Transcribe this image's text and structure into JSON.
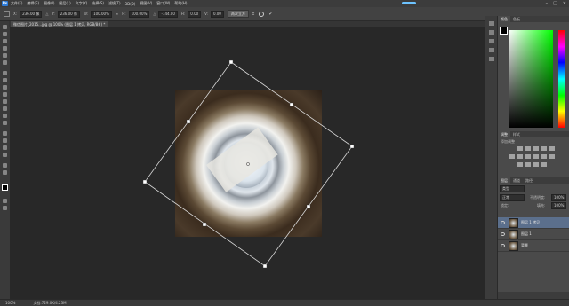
{
  "app": {
    "logo": "Ps"
  },
  "menu": [
    "文件(F)",
    "编辑(E)",
    "图像(I)",
    "图层(L)",
    "文字(Y)",
    "选择(S)",
    "滤镜(T)",
    "3D(D)",
    "视图(V)",
    "窗口(W)",
    "帮助(H)"
  ],
  "options": {
    "x_label": "X:",
    "x_value": "236.00 像",
    "y_label": "Y:",
    "y_value": "236.00 像",
    "w_label": "W:",
    "w_value": "100.00%",
    "h_label": "H:",
    "h_value": "100.00%",
    "angle_label": "△",
    "angle_value": "-144.00",
    "hskew_label": "H:",
    "hskew_value": "0.00",
    "vskew_label": "V:",
    "vskew_value": "0.00",
    "interp_value": "两次立方"
  },
  "document_tab": "微信图片_2015...jpg @ 100% (图层 1 拷贝, RGB/8#) *",
  "panels": {
    "color_tabs": [
      "颜色",
      "色板"
    ],
    "adjust_tabs": [
      "调整",
      "样式"
    ],
    "adjust_title": "添加调整",
    "layers_tabs": [
      "图层",
      "通道",
      "路径"
    ],
    "kind_label": "类型",
    "blend_mode": "正常",
    "opacity_label": "不透明度:",
    "opacity_value": "100%",
    "lock_label": "锁定:",
    "fill_label": "填充:",
    "fill_value": "100%",
    "layers": [
      {
        "name": "图层 1 拷贝",
        "selected": true
      },
      {
        "name": "图层 1",
        "selected": false
      },
      {
        "name": "背景",
        "selected": false
      }
    ]
  },
  "status": {
    "zoom": "100%",
    "doc": "文档:729.0K/4.23M"
  },
  "colors": {
    "accent": "#5b6f8c",
    "canvas": "#282828"
  }
}
